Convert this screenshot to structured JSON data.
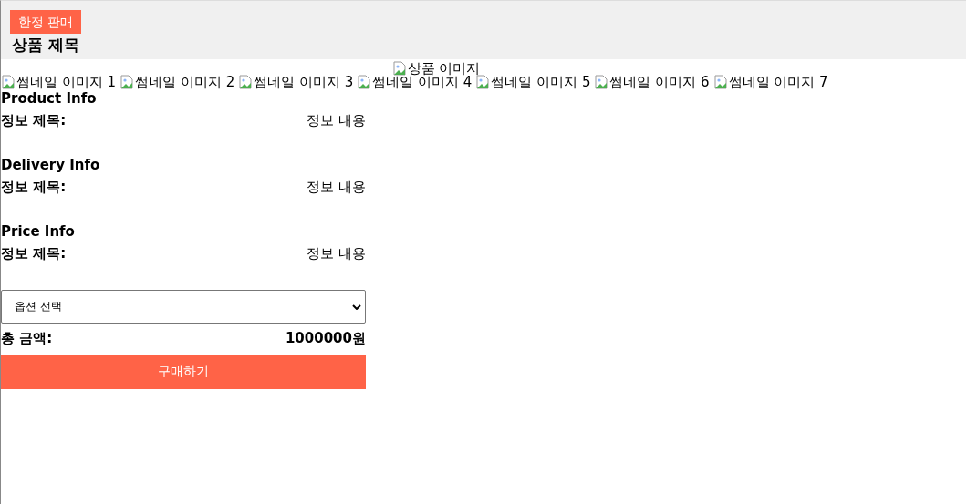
{
  "header": {
    "badge": "한정 판매",
    "title": "상품 제목"
  },
  "main_image": {
    "alt": "상품 이미지"
  },
  "thumbnails": [
    {
      "alt": "썸네일 이미지 1"
    },
    {
      "alt": "썸네일 이미지 2"
    },
    {
      "alt": "썸네일 이미지 3"
    },
    {
      "alt": "썸네일 이미지 4"
    },
    {
      "alt": "썸네일 이미지 5"
    },
    {
      "alt": "썸네일 이미지 6"
    },
    {
      "alt": "썸네일 이미지 7"
    }
  ],
  "sections": [
    {
      "heading": "Product Info",
      "label": "정보 제목:",
      "value": "정보 내용"
    },
    {
      "heading": "Delivery Info",
      "label": "정보 제목:",
      "value": "정보 내용"
    },
    {
      "heading": "Price Info",
      "label": "정보 제목:",
      "value": "정보 내용"
    }
  ],
  "option_select": {
    "value": "옵션 선택"
  },
  "total": {
    "label": "총 금액:",
    "value": "1000000원"
  },
  "buy_button": "구매하기"
}
